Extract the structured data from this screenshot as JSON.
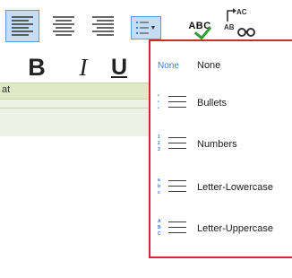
{
  "toolbar": {
    "bold_label": "B",
    "italic_label": "I",
    "underline_label": "U",
    "spellcheck_label": "ABC",
    "find_replace_top": "AC",
    "find_replace_bottom": "AB"
  },
  "lower_panel": {
    "label_fragment": "at"
  },
  "list_menu": {
    "items": [
      {
        "icon_text": "None",
        "label": "None"
      },
      {
        "label": "Bullets",
        "markers": [
          "•",
          "•",
          "•"
        ]
      },
      {
        "label": "Numbers",
        "markers": [
          "1",
          "2",
          "3"
        ]
      },
      {
        "label": "Letter-Lowercase",
        "markers": [
          "a",
          "b",
          "c"
        ]
      },
      {
        "label": "Letter-Uppercase",
        "markers": [
          "A",
          "B",
          "C"
        ]
      }
    ]
  },
  "colors": {
    "selected_bg": "#c5dcf5",
    "selected_border": "#5b9bd5",
    "menu_border": "#cc2b2b",
    "marker_blue": "#3a7bd5",
    "panel_green": "#dfe9c8"
  }
}
